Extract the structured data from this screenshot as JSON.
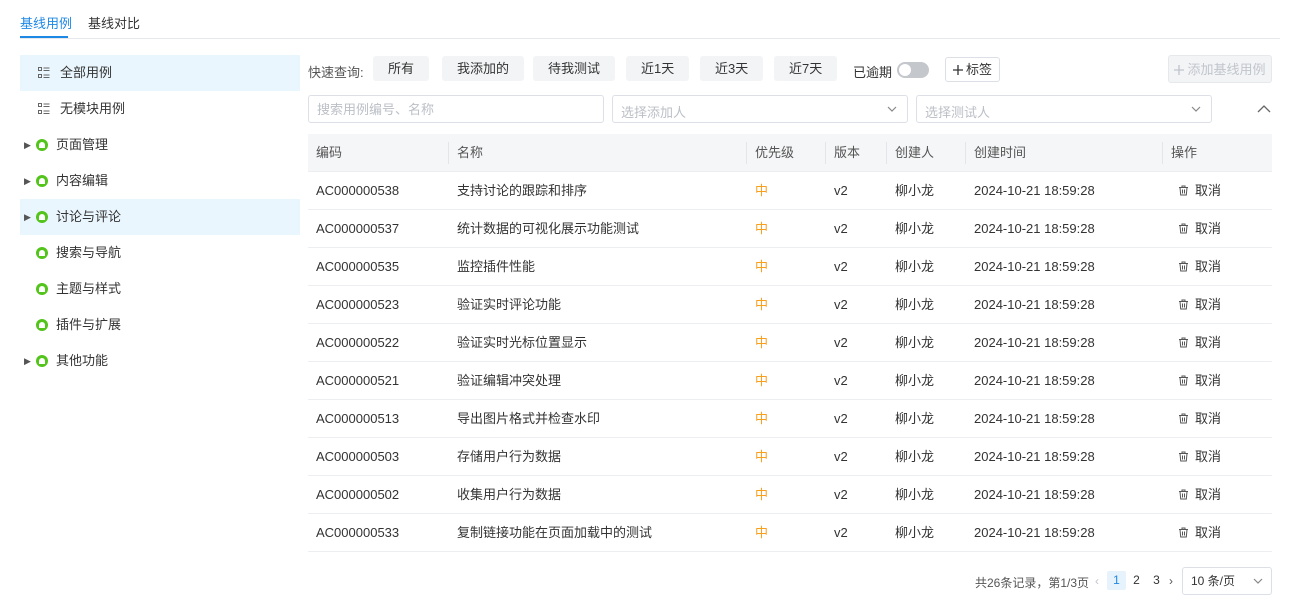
{
  "tabs": [
    {
      "label": "基线用例",
      "active": true
    },
    {
      "label": "基线对比",
      "active": false
    }
  ],
  "sidebar": {
    "items": [
      {
        "label": "全部用例",
        "icon": "list-icon",
        "expandable": false,
        "active": true
      },
      {
        "label": "无模块用例",
        "icon": "list-icon",
        "expandable": false,
        "active": false
      },
      {
        "label": "页面管理",
        "icon": "module-icon",
        "expandable": true,
        "active": false
      },
      {
        "label": "内容编辑",
        "icon": "module-icon",
        "expandable": true,
        "active": false
      },
      {
        "label": "讨论与评论",
        "icon": "module-icon",
        "expandable": true,
        "active": true
      },
      {
        "label": "搜索与导航",
        "icon": "module-icon",
        "expandable": false,
        "active": false
      },
      {
        "label": "主题与样式",
        "icon": "module-icon",
        "expandable": false,
        "active": false
      },
      {
        "label": "插件与扩展",
        "icon": "module-icon",
        "expandable": false,
        "active": false
      },
      {
        "label": "其他功能",
        "icon": "module-icon",
        "expandable": true,
        "active": false
      }
    ]
  },
  "quick_filter": {
    "label": "快速查询:",
    "buttons": [
      "所有",
      "我添加的",
      "待我测试",
      "近1天",
      "近3天",
      "近7天"
    ],
    "overdue_label": "已逾期",
    "overdue_on": false,
    "tag_label": "标签"
  },
  "add_button_label": "添加基线用例",
  "filters": {
    "search_placeholder": "搜索用例编号、名称",
    "adder_placeholder": "选择添加人",
    "tester_placeholder": "选择测试人"
  },
  "table": {
    "headers": [
      "编码",
      "名称",
      "优先级",
      "版本",
      "创建人",
      "创建时间",
      "操作"
    ],
    "action_label": "取消",
    "rows": [
      {
        "code": "AC000000538",
        "name": "支持讨论的跟踪和排序",
        "priority": "中",
        "version": "v2",
        "creator": "柳小龙",
        "created": "2024-10-21 18:59:28"
      },
      {
        "code": "AC000000537",
        "name": "统计数据的可视化展示功能测试",
        "priority": "中",
        "version": "v2",
        "creator": "柳小龙",
        "created": "2024-10-21 18:59:28"
      },
      {
        "code": "AC000000535",
        "name": "监控插件性能",
        "priority": "中",
        "version": "v2",
        "creator": "柳小龙",
        "created": "2024-10-21 18:59:28"
      },
      {
        "code": "AC000000523",
        "name": "验证实时评论功能",
        "priority": "中",
        "version": "v2",
        "creator": "柳小龙",
        "created": "2024-10-21 18:59:28"
      },
      {
        "code": "AC000000522",
        "name": "验证实时光标位置显示",
        "priority": "中",
        "version": "v2",
        "creator": "柳小龙",
        "created": "2024-10-21 18:59:28"
      },
      {
        "code": "AC000000521",
        "name": "验证编辑冲突处理",
        "priority": "中",
        "version": "v2",
        "creator": "柳小龙",
        "created": "2024-10-21 18:59:28"
      },
      {
        "code": "AC000000513",
        "name": "导出图片格式并检查水印",
        "priority": "中",
        "version": "v2",
        "creator": "柳小龙",
        "created": "2024-10-21 18:59:28"
      },
      {
        "code": "AC000000503",
        "name": "存储用户行为数据",
        "priority": "中",
        "version": "v2",
        "creator": "柳小龙",
        "created": "2024-10-21 18:59:28"
      },
      {
        "code": "AC000000502",
        "name": "收集用户行为数据",
        "priority": "中",
        "version": "v2",
        "creator": "柳小龙",
        "created": "2024-10-21 18:59:28"
      },
      {
        "code": "AC000000533",
        "name": "复制链接功能在页面加载中的测试",
        "priority": "中",
        "version": "v2",
        "creator": "柳小龙",
        "created": "2024-10-21 18:59:28"
      }
    ]
  },
  "pagination": {
    "summary": "共26条记录，第1/3页",
    "pages": [
      "1",
      "2",
      "3"
    ],
    "current": "1",
    "page_size": "10 条/页"
  },
  "colors": {
    "accent": "#1e88e5",
    "priority_medium": "#fa9f1b",
    "module_icon": "#52c41a"
  }
}
